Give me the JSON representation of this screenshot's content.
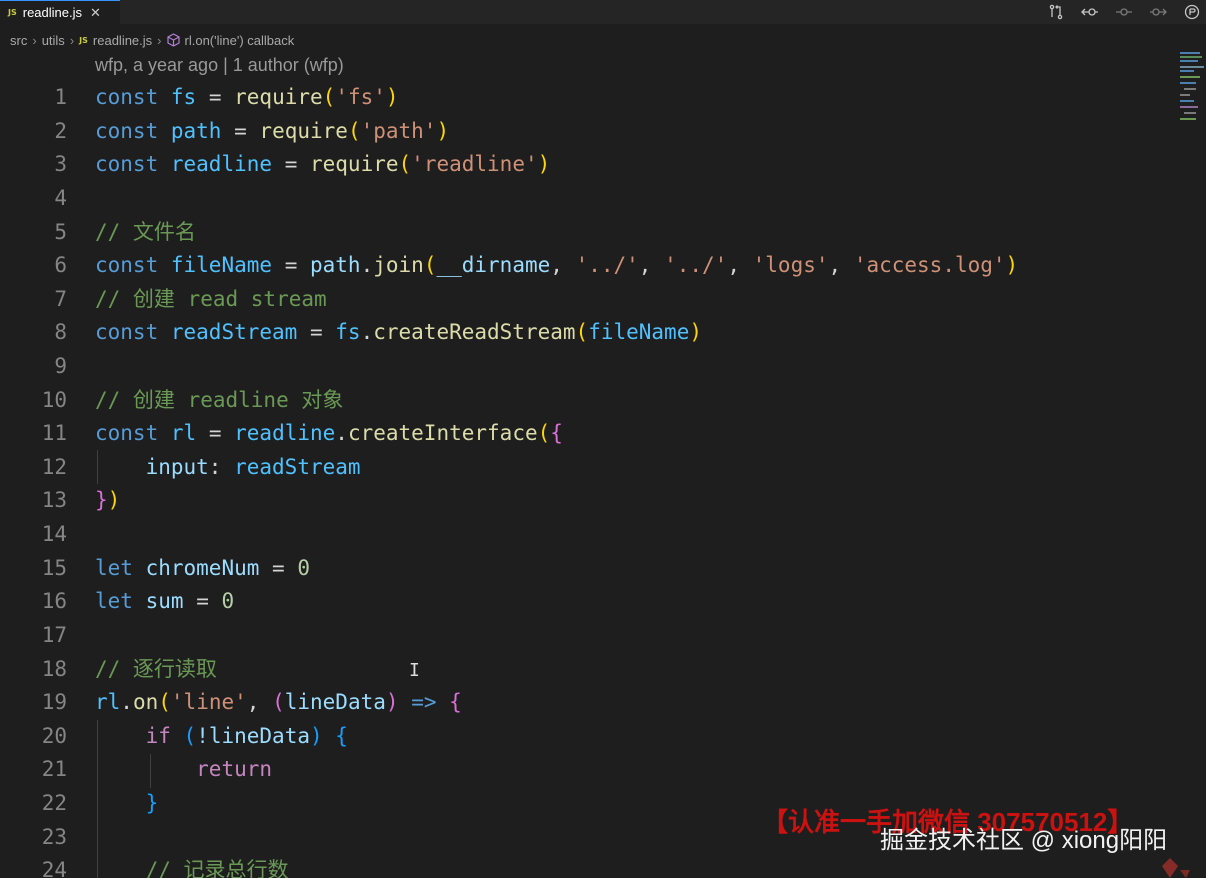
{
  "tab": {
    "file_badge": "JS",
    "label": "readline.js",
    "close": "✕"
  },
  "breadcrumb": {
    "items": [
      "src",
      "utils",
      "readline.js",
      "rl.on('line') callback"
    ],
    "js_badge": "JS"
  },
  "blame": "wfp, a year ago | 1 author (wfp)",
  "line_numbers": [
    "1",
    "2",
    "3",
    "4",
    "5",
    "6",
    "7",
    "8",
    "9",
    "10",
    "11",
    "12",
    "13",
    "14",
    "15",
    "16",
    "17",
    "18",
    "19",
    "20",
    "21",
    "22",
    "23",
    "24"
  ],
  "code": {
    "l1": [
      "const",
      "fs",
      "=",
      "require",
      "(",
      "'fs'",
      ")"
    ],
    "l2": [
      "const",
      "path",
      "=",
      "require",
      "(",
      "'path'",
      ")"
    ],
    "l3": [
      "const",
      "readline",
      "=",
      "require",
      "(",
      "'readline'",
      ")"
    ],
    "l5": "// 文件名",
    "l6": [
      "const",
      "fileName",
      "=",
      "path",
      ".",
      "join",
      "(",
      "__dirname",
      ",",
      "'../'",
      ",",
      "'../'",
      ",",
      "'logs'",
      ",",
      "'access.log'",
      ")"
    ],
    "l7": "// 创建 read stream",
    "l8": [
      "const",
      "readStream",
      "=",
      "fs",
      ".",
      "createReadStream",
      "(",
      "fileName",
      ")"
    ],
    "l10": "// 创建 readline 对象",
    "l11": [
      "const",
      "rl",
      "=",
      "readline",
      ".",
      "createInterface",
      "(",
      "{"
    ],
    "l12": [
      "input",
      ":",
      "readStream"
    ],
    "l13": [
      "}",
      ")"
    ],
    "l15": [
      "let",
      "chromeNum",
      "=",
      "0"
    ],
    "l16": [
      "let",
      "sum",
      "=",
      "0"
    ],
    "l18": "// 逐行读取",
    "l19": [
      "rl",
      ".",
      "on",
      "(",
      "'line'",
      ",",
      "(",
      "lineData",
      ")",
      "=>",
      "{"
    ],
    "l20": [
      "if",
      "(",
      "!lineData",
      ")",
      "{"
    ],
    "l21": [
      "return"
    ],
    "l22": [
      "}"
    ],
    "l24": "// 记录总行数"
  },
  "watermark": {
    "wechat": "【认准一手加微信 307570512】",
    "site": "掘金技术社区 @ xiong阳阳"
  },
  "colors": {
    "background": "#1e1e1e",
    "keyword": "#569cd6",
    "control": "#c586c0",
    "constant": "#4fc1ff",
    "variable": "#9cdcfe",
    "function": "#dcdcaa",
    "string": "#ce9178",
    "comment": "#6a9955",
    "number": "#b5cea8"
  },
  "icons": [
    "javascript-file-icon",
    "close-icon",
    "git-compare-icon",
    "go-back-icon",
    "git-commit-icon",
    "go-forward-icon",
    "copilot-icon",
    "symbol-method-icon",
    "text-cursor-icon"
  ]
}
